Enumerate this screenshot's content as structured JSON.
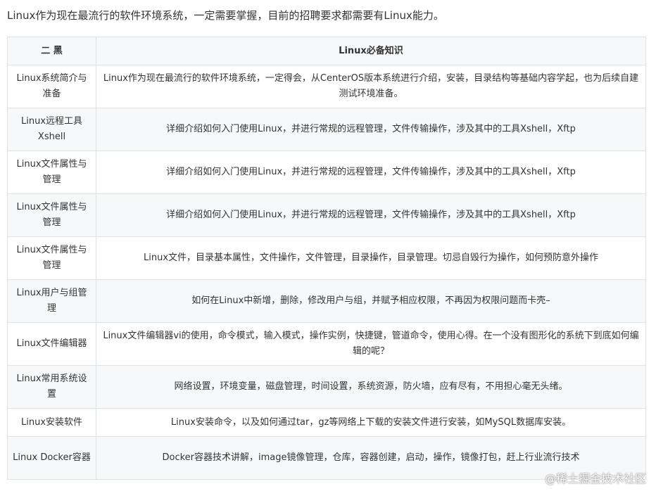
{
  "intro": "Linux作为现在最流行的软件环境系统，一定需要掌握，目前的招聘要求都需要有Linux能力。",
  "table": {
    "headers": [
      "二 黑",
      "Linux必备知识"
    ],
    "rows": [
      {
        "module": "Linux系统简介与准备",
        "content": "Linux作为现在最流行的软件环境系统，一定得会，从CenterOS版本系统进行介绍，安装，目录结构等基础内容学起，也为后续自建测试环境准备。"
      },
      {
        "module": "Linux远程工具Xshell",
        "content": "详细介绍如何入门使用Linux，并进行常规的远程管理，文件传输操作，涉及其中的工具Xshell，Xftp"
      },
      {
        "module": "Linux文件属性与管理",
        "content": "详细介绍如何入门使用Linux，并进行常规的远程管理，文件传输操作，涉及其中的工具Xshell，Xftp"
      },
      {
        "module": "Linux文件属性与管理",
        "content": "详细介绍如何入门使用Linux，并进行常规的远程管理，文件传输操作，涉及其中的工具Xshell，Xftp"
      },
      {
        "module": "Linux文件属性与管理",
        "content": "Linux文件，目录基本属性，文件操作，文件管理，目录操作，目录管理。切忌自毁行为操作，如何预防意外操作"
      },
      {
        "module": "Linux用户与组管理",
        "content": "如何在Linux中新增，删除，修改用户与组，并赋予相应权限，不再因为权限问题而卡壳–"
      },
      {
        "module": "Linux文件编辑器",
        "content": "Linux文件编辑器vi的使用，命令模式，输入模式，操作实例，快捷键，管道命令，使用心得。在一个没有图形化的系统下到底如何编辑的呢？"
      },
      {
        "module": "Linux常用系统设置",
        "content": "网络设置，环境变量，磁盘管理，时间设置，系统资源，防火墙，应有尽有，不用担心毫无头绪。"
      },
      {
        "module": "Linux安装软件",
        "content": "Linux安装命令，以及如何通过tar，gz等网络上下载的安装文件进行安装，如MySQL数据库安装。"
      },
      {
        "module": "Linux Docker容器",
        "content": "Docker容器技术讲解，image镜像管理，仓库，容器创建，启动，操作，镜像打包，赶上行业流行技术"
      }
    ]
  },
  "watermark": "@稀土掘金技术社区"
}
